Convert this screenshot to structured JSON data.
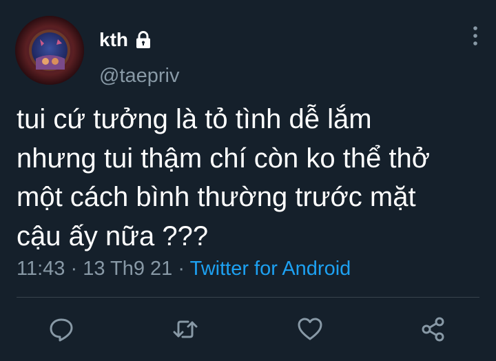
{
  "author": {
    "display_name": "kth",
    "handle": "@taepriv",
    "protected": true,
    "avatar_icon": "avatar-image",
    "lock_icon": "lock-icon"
  },
  "tweet": {
    "text": "tui cứ tưởng là tỏ tình dễ lắm\nnhưng tui thậm chí còn ko thể thở\nmột cách bình thường trước mặt\ncậu ấy nữa ???",
    "time": "11:43",
    "date": "13 Th9 21",
    "separator": "·",
    "source": "Twitter for Android"
  },
  "actions": {
    "reply_icon": "reply-icon",
    "retweet_icon": "retweet-icon",
    "like_icon": "heart-icon",
    "share_icon": "share-icon",
    "more_icon": "more-vertical-icon"
  },
  "colors": {
    "background": "#15202b",
    "text": "#ffffff",
    "secondary": "#8899a6",
    "accent": "#1da1f2",
    "divider": "#38444d"
  }
}
